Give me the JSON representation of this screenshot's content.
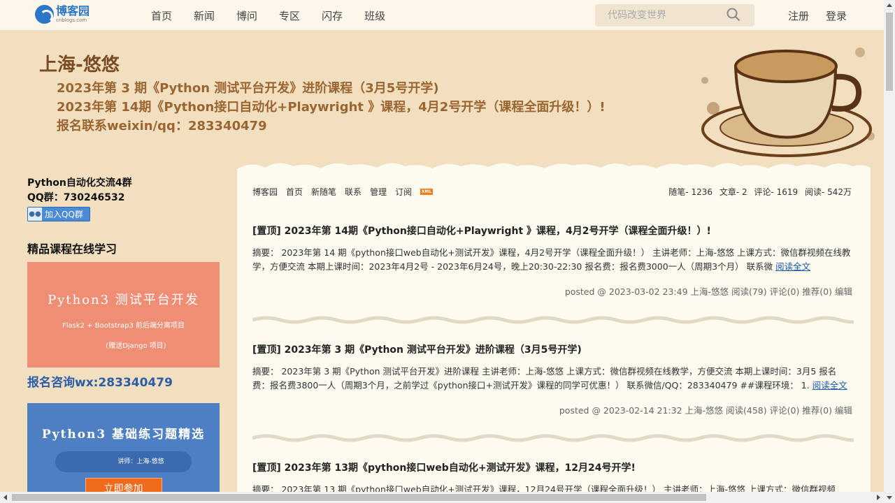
{
  "topnav": {
    "logo_cn": "博客园",
    "logo_en": "cnblogs.com",
    "links": [
      "首页",
      "新闻",
      "博问",
      "专区",
      "闪存",
      "班级"
    ],
    "search_placeholder": "代码改变世界",
    "register": "注册",
    "login": "登录"
  },
  "header": {
    "title": "上海-悠悠",
    "lines": [
      "2023年第 3 期《Python 测试平台开发》进阶课程（3月5号开学)",
      "2023年第 14期《Python接口自动化+Playwright 》课程，4月2号开学（课程全面升级！）!",
      "报名联系weixin/qq：283340479"
    ]
  },
  "sidebar": {
    "qq_title": "Python自动化交流4群",
    "qq_number": "QQ群：730246532",
    "qq_button": "加入QQ群",
    "section_title": "精品课程在线学习",
    "ad1": {
      "title": "Python3 测试平台开发",
      "subtitle": "Flask2 + Bootstrap3 前后端分离项目",
      "note": "(赠送Django 项目)"
    },
    "consult": "报名咨询wx:283340479",
    "ad2": {
      "title": "Python3 基础练习题精选",
      "teacher": "讲师：上海-悠悠",
      "button": "立即参加"
    }
  },
  "main": {
    "nav": [
      "博客园",
      "首页",
      "新随笔",
      "联系",
      "管理",
      "订阅"
    ],
    "xml_badge": "XML",
    "stats": [
      "随笔- 1236",
      "文章- 2",
      "评论- 1619",
      "阅读- 542万"
    ],
    "posts": [
      {
        "title": "[置顶] 2023年第 14期《Python接口自动化+Playwright 》课程，4月2号开学（课程全面升级！）!",
        "summary": "摘要： 2023年第 14 期《python接口web自动化+测试开发》课程，4月2号开学（课程全面升级！） 主讲老师：上海-悠悠 上课方式：微信群视频在线教学，方便交流 本期上课时间：2023年4月2号 - 2023年6月24号，晚上20:30-22:30 报名费：报名费3000一人（周期3个月） 联系微 ",
        "read_more": "阅读全文",
        "meta": "posted @ 2023-03-02 23:49 上海-悠悠 阅读(79) 评论(0) 推荐(0) ",
        "edit": "编辑"
      },
      {
        "title": "[置顶] 2023年第 3 期《Python 测试平台开发》进阶课程（3月5号开学)",
        "summary": "摘要： 2023年第 3 期《Python 测试平台开发》进阶课程 主讲老师：上海-悠悠 上课方式：微信群视频在线教学，方便交流 本期上课时间：3月5 报名费：报名费3800一人（周期3个月，之前学过《python接口+测试开发》课程的同学可优惠！） 联系微信/QQ：283340479 ##课程环境： 1. ",
        "read_more": "阅读全文",
        "meta": "posted @ 2023-02-14 21:32 上海-悠悠 阅读(458) 评论(0) 推荐(0) ",
        "edit": "编辑"
      },
      {
        "title": "[置顶] 2023年第 13期《python接口web自动化+测试开发》课程，12月24号开学!",
        "summary": "摘要： 2023年第 13 期《python接口web自动化+测试开发》课程，12月24号开学（课程全面升级！） 主讲老师：上海-悠悠 上课方式：微信群视频",
        "read_more": "",
        "meta": "",
        "edit": ""
      }
    ]
  }
}
